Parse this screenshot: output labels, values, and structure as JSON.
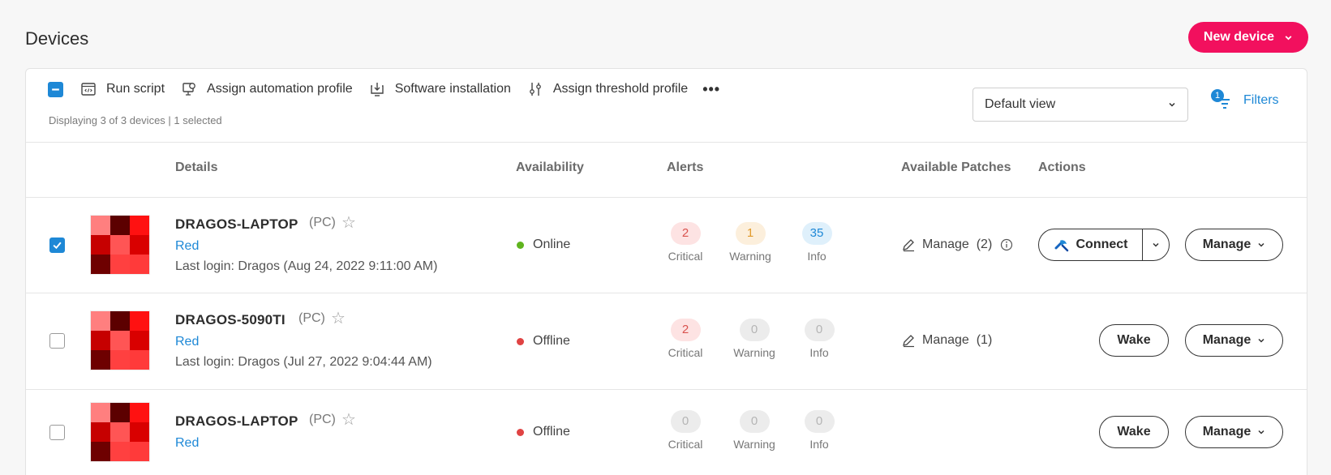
{
  "page": {
    "title": "Devices",
    "new_device_label": "New device"
  },
  "toolbar": {
    "run_script": "Run script",
    "assign_automation": "Assign automation profile",
    "software_install": "Software installation",
    "assign_threshold": "Assign threshold profile",
    "more": "•••",
    "display_count": "Displaying 3 of 3 devices | 1 selected",
    "view_select": "Default view",
    "filters_label": "Filters",
    "filters_count": "1"
  },
  "columns": {
    "details": "Details",
    "availability": "Availability",
    "alerts": "Alerts",
    "patches": "Available Patches",
    "actions": "Actions"
  },
  "alert_labels": {
    "critical": "Critical",
    "warning": "Warning",
    "info": "Info"
  },
  "colors": {
    "accent": "#f2105e",
    "link": "#1e88d6",
    "online": "#5fb41e",
    "offline": "#e04343"
  },
  "devices": [
    {
      "name": "DRAGOS-LAPTOP",
      "type": "(PC)",
      "group": "Red",
      "last_login": "Last login: Dragos (Aug 24, 2022 9:11:00 AM)",
      "selected": true,
      "status": "Online",
      "alerts": {
        "critical": "2",
        "warning": "1",
        "info": "35"
      },
      "patches": "Manage  (2)",
      "primary_action": "Connect",
      "manage_label": "Manage"
    },
    {
      "name": "DRAGOS-5090TI",
      "type": "(PC)",
      "group": "Red",
      "last_login": "Last login: Dragos (Jul 27, 2022 9:04:44 AM)",
      "selected": false,
      "status": "Offline",
      "alerts": {
        "critical": "2",
        "warning": "0",
        "info": "0"
      },
      "patches": "Manage  (1)",
      "primary_action": "Wake",
      "manage_label": "Manage"
    },
    {
      "name": "DRAGOS-LAPTOP",
      "type": "(PC)",
      "group": "Red",
      "last_login": "",
      "selected": false,
      "status": "Offline",
      "alerts": {
        "critical": "0",
        "warning": "0",
        "info": "0"
      },
      "patches": "",
      "primary_action": "Wake",
      "manage_label": "Manage"
    }
  ]
}
